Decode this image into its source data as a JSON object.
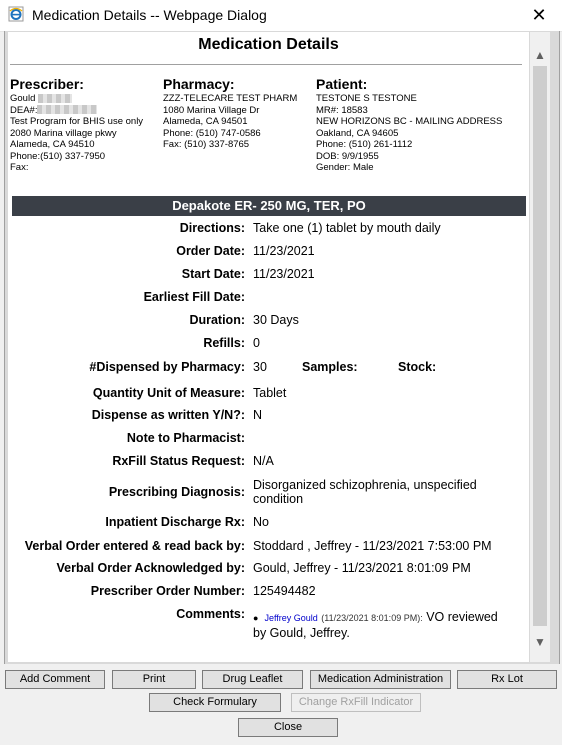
{
  "window": {
    "title": "Medication Details -- Webpage Dialog",
    "close_glyph": "✕"
  },
  "page": {
    "heading": "Medication Details"
  },
  "prescriber": {
    "heading": "Prescriber:",
    "name": "Gould",
    "dea": "DEA#:",
    "lines": [
      "Test Program for BHIS use only",
      "2080 Marina village pkwy",
      "Alameda, CA 94510",
      "Phone:(510) 337-7950",
      "Fax:"
    ]
  },
  "pharmacy": {
    "heading": "Pharmacy:",
    "lines": [
      "ZZZ-TELECARE TEST PHARM",
      "1080 Marina Village Dr",
      "Alameda, CA 94501",
      "Phone: (510) 747-0586",
      "Fax: (510) 337-8765"
    ]
  },
  "patient": {
    "heading": "Patient:",
    "lines": [
      "TESTONE S TESTONE",
      "MR#: 18583",
      "NEW HORIZONS BC - MAILING ADDRESS",
      "Oakland, CA 94605",
      "Phone: (510) 261-1112",
      "DOB: 9/9/1955",
      "Gender: Male"
    ]
  },
  "drug": {
    "title": "Depakote ER- 250 MG, TER, PO"
  },
  "details": {
    "directions": {
      "label": "Directions:",
      "value": "Take one (1) tablet by mouth daily"
    },
    "order_date": {
      "label": "Order Date:",
      "value": "11/23/2021"
    },
    "start_date": {
      "label": "Start Date:",
      "value": "11/23/2021"
    },
    "earliest_fill": {
      "label": "Earliest Fill Date:",
      "value": ""
    },
    "duration": {
      "label": "Duration:",
      "value": "30 Days"
    },
    "refills": {
      "label": "Refills:",
      "value": "0"
    },
    "dispensed": {
      "label": "#Dispensed by Pharmacy:",
      "value": "30",
      "samples_label": "Samples:",
      "stock_label": "Stock:"
    },
    "quantity_unit": {
      "label": "Quantity Unit of Measure:",
      "value": "Tablet"
    },
    "daw": {
      "label": "Dispense as written Y/N?:",
      "value": "N"
    },
    "note": {
      "label": "Note to Pharmacist:",
      "value": ""
    },
    "rxfill": {
      "label": "RxFill Status Request:",
      "value": "N/A"
    },
    "diagnosis": {
      "label": "Prescribing Diagnosis:",
      "value": "Disorganized schizophrenia, unspecified condition"
    },
    "inpatient": {
      "label": "Inpatient Discharge Rx:",
      "value": "No"
    },
    "verbal_entered": {
      "label": "Verbal Order entered & read back by:",
      "value": "Stoddard , Jeffrey - 11/23/2021 7:53:00 PM"
    },
    "verbal_ack": {
      "label": "Verbal Order Acknowledged by:",
      "value": "Gould, Jeffrey - 11/23/2021 8:01:09 PM"
    },
    "prescriber_order": {
      "label": "Prescriber Order Number:",
      "value": "125494482"
    },
    "comments": {
      "label": "Comments:",
      "bullet": "●",
      "author": "Jeffrey Gould",
      "time": "(11/23/2021 8:01:09 PM):",
      "text": "VO reviewed",
      "text2": "by Gould, Jeffrey."
    }
  },
  "buttons": {
    "add_comment": "Add Comment",
    "print": "Print",
    "drug_leaflet": "Drug Leaflet",
    "med_admin": "Medication Administration",
    "rx_lot": "Rx Lot",
    "check_formulary": "Check Formulary",
    "change_rxfill": "Change RxFill Indicator",
    "close": "Close"
  },
  "scrollbar": {
    "up": "▲",
    "down": "▼"
  }
}
